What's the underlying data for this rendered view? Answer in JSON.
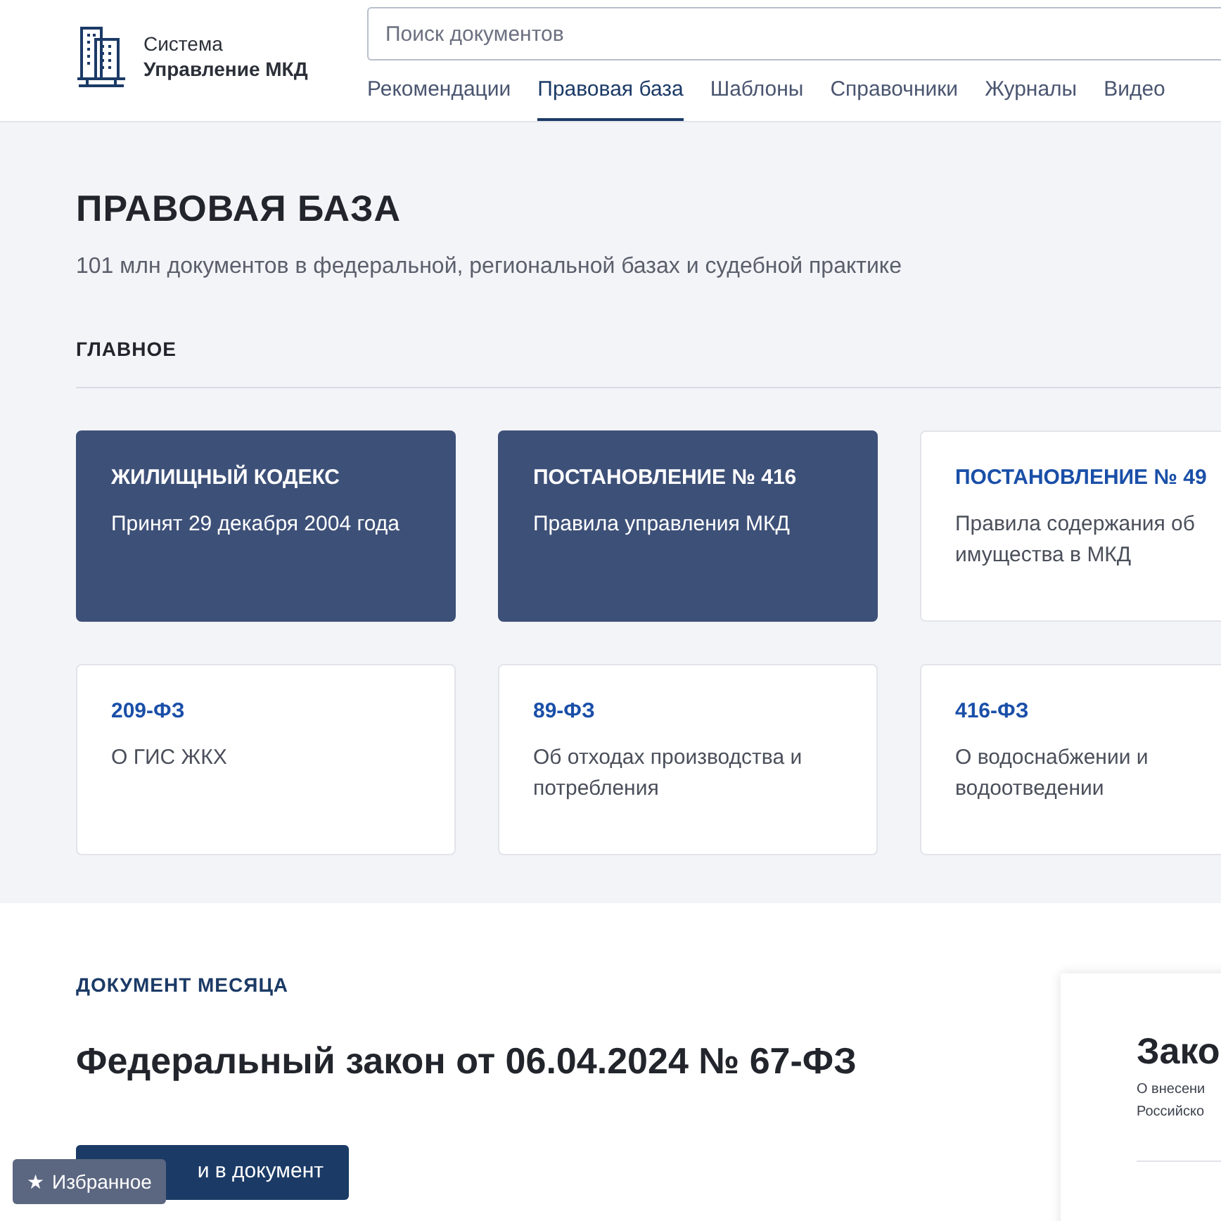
{
  "header": {
    "logo": {
      "line1": "Система",
      "line2": "Управление МКД"
    },
    "search": {
      "placeholder": "Поиск документов"
    },
    "nav": [
      {
        "label": "Рекомендации",
        "selected": false
      },
      {
        "label": "Правовая база",
        "selected": true
      },
      {
        "label": "Шаблоны",
        "selected": false
      },
      {
        "label": "Справочники",
        "selected": false
      },
      {
        "label": "Журналы",
        "selected": false
      },
      {
        "label": "Видео",
        "selected": false
      }
    ]
  },
  "page": {
    "title": "ПРАВОВАЯ БАЗА",
    "subtitle": "101 млн документов в федеральной, региональной базах и судебной практике",
    "section": "ГЛАВНОЕ",
    "cards": [
      {
        "kind": "filled",
        "title": "ЖИЛИЩНЫЙ КОДЕКС",
        "text": "Принят 29 декабря 2004 года"
      },
      {
        "kind": "filled",
        "title": "ПОСТАНОВЛЕНИЕ № 416",
        "text": "Правила управления МКД"
      },
      {
        "kind": "outline",
        "title": "ПОСТАНОВЛЕНИЕ № 49",
        "text_lines": [
          "Правила содержания об",
          "имущества в МКД"
        ]
      },
      {
        "kind": "outline",
        "title": "209-ФЗ",
        "text": "О ГИС ЖКХ"
      },
      {
        "kind": "outline",
        "title": "89-ФЗ",
        "text": "Об отходах производства и потребления"
      },
      {
        "kind": "outline",
        "title": "416-ФЗ",
        "text": "О водоснабжении и водоотведении"
      }
    ]
  },
  "month_doc": {
    "label": "ДОКУМЕНТ МЕСЯЦА",
    "title": "Федеральный закон от 06.04.2024 № 67-ФЗ",
    "button": "и в документ",
    "preview": {
      "title": "Зако",
      "lines": [
        "О внесени",
        "Российско"
      ]
    }
  },
  "favorites": {
    "label": "Избранное",
    "icon": "★"
  }
}
